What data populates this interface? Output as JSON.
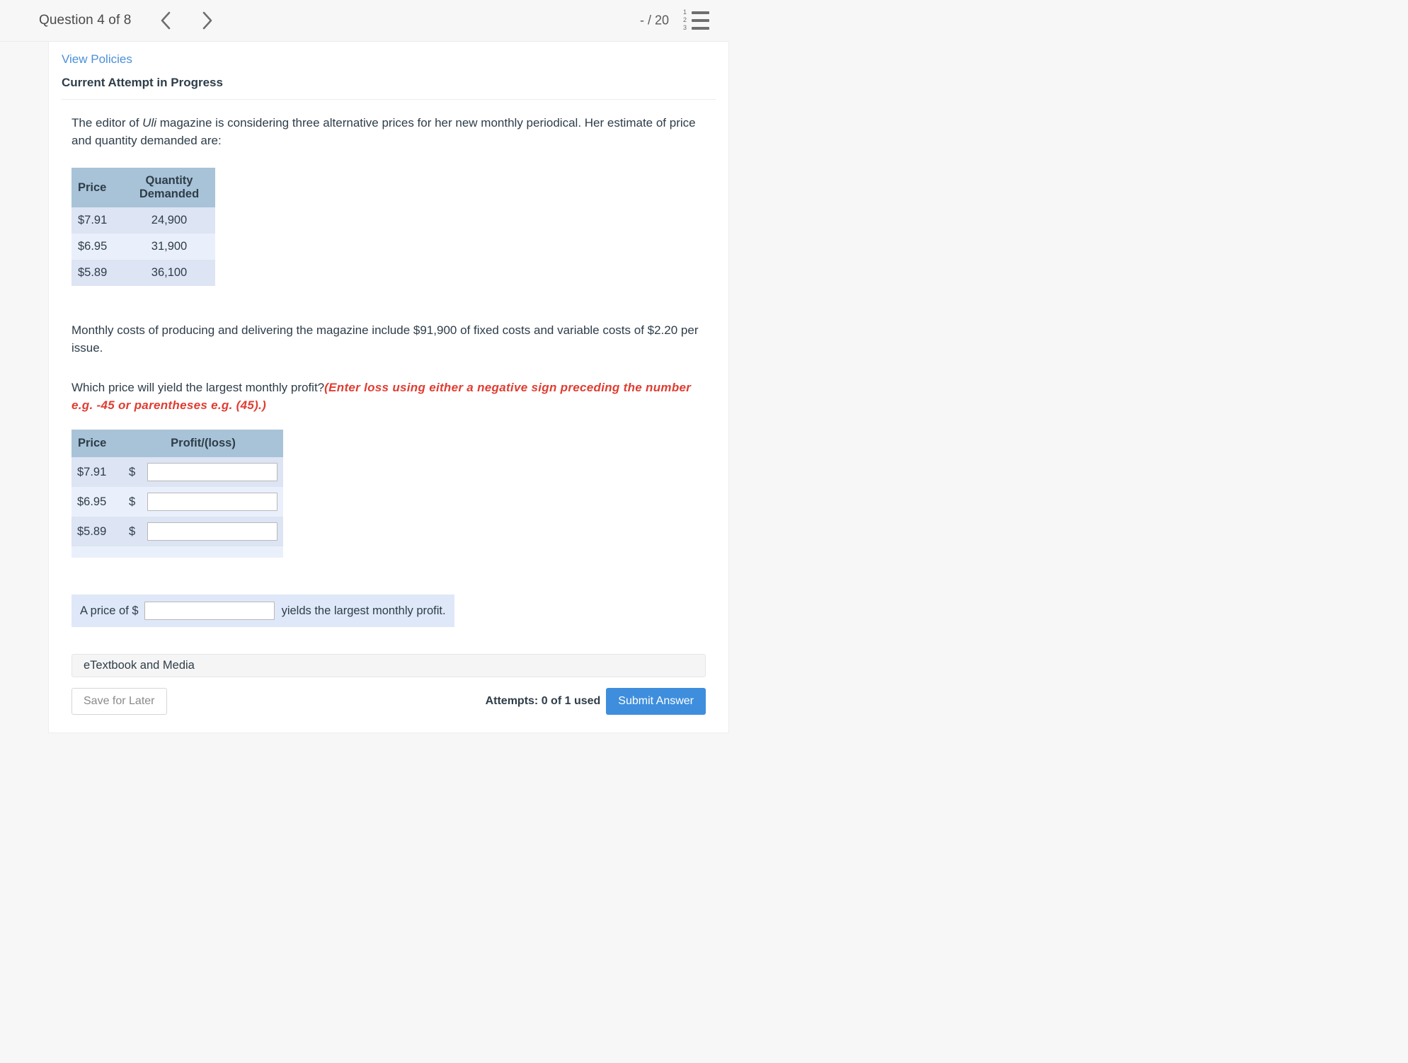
{
  "header": {
    "question_counter": "Question 4 of 8",
    "prev_icon": "chevron-left-icon",
    "next_icon": "chevron-right-icon",
    "score": "- / 20",
    "list_icon": "numbered-list-icon",
    "list_numbers": [
      "1",
      "2",
      "3"
    ]
  },
  "card": {
    "view_policies": "View Policies",
    "attempt_status": "Current Attempt in Progress"
  },
  "question": {
    "intro_part1": "The editor of ",
    "intro_italic": "Uli",
    "intro_part2": " magazine is considering three alternative prices for her new monthly periodical. Her estimate of price and quantity demanded are:",
    "costs_paragraph": "Monthly costs of producing and delivering the magazine include $91,900 of fixed costs and variable costs of $2.20 per issue.",
    "prompt": "Which price will yield the largest monthly profit?",
    "prompt_note": "(Enter loss using either a negative sign preceding the number e.g. -45 or parentheses e.g. (45).)"
  },
  "demand_table": {
    "headers": [
      "Price",
      "Quantity Demanded"
    ],
    "rows": [
      {
        "price": "$7.91",
        "quantity": "24,900"
      },
      {
        "price": "$6.95",
        "quantity": "31,900"
      },
      {
        "price": "$5.89",
        "quantity": "36,100"
      }
    ]
  },
  "answer_table": {
    "headers": [
      "Price",
      "Profit/(loss)"
    ],
    "currency_symbol": "$",
    "rows": [
      {
        "price": "$7.91",
        "value": "",
        "placeholder": ""
      },
      {
        "price": "$6.95",
        "value": "",
        "placeholder": ""
      },
      {
        "price": "$5.89",
        "value": "",
        "placeholder": ""
      }
    ]
  },
  "final_answer": {
    "label": "A price of $",
    "value": "",
    "placeholder": "",
    "tail": "yields the largest monthly profit."
  },
  "footer": {
    "etextbook_label": "eTextbook and Media",
    "save_label": "Save for Later",
    "attempts_label": "Attempts: 0 of 1 used",
    "submit_label": "Submit Answer"
  },
  "colors": {
    "accent_link": "#4a90d9",
    "table_header": "#a8c3d7",
    "row_odd": "#dde4f3",
    "row_even": "#eaf0fb",
    "note_red": "#e03c31",
    "submit_blue": "#3e8edd",
    "strip_blue": "#dfe8f8"
  }
}
